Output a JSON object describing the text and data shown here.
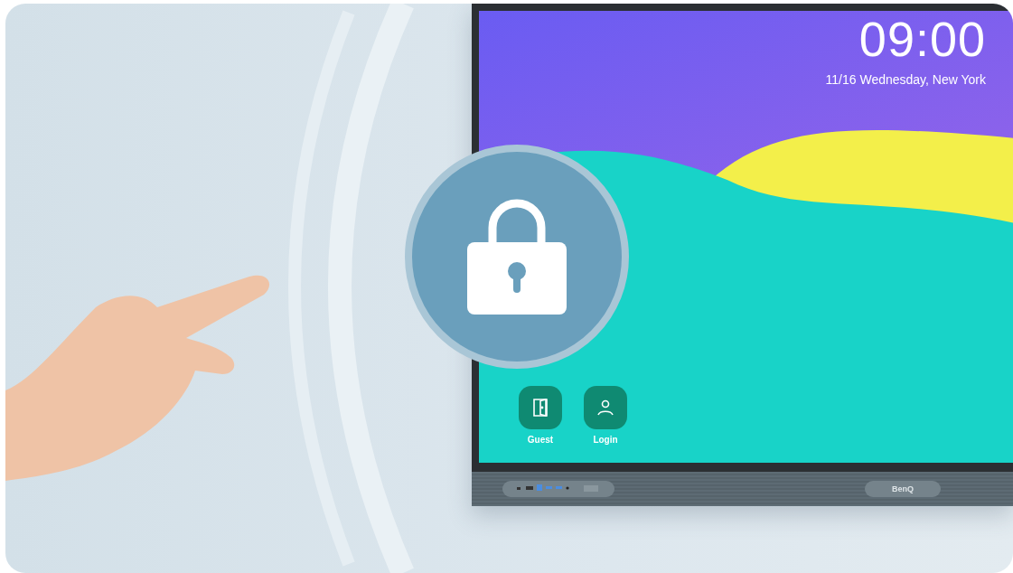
{
  "clock": {
    "time": "09:00",
    "date": "11/16 Wednesday, New York"
  },
  "apps": [
    {
      "kind": "guest",
      "label": "Guest"
    },
    {
      "kind": "login",
      "label": "Login"
    }
  ],
  "bezel": {
    "logo": "BenQ"
  }
}
